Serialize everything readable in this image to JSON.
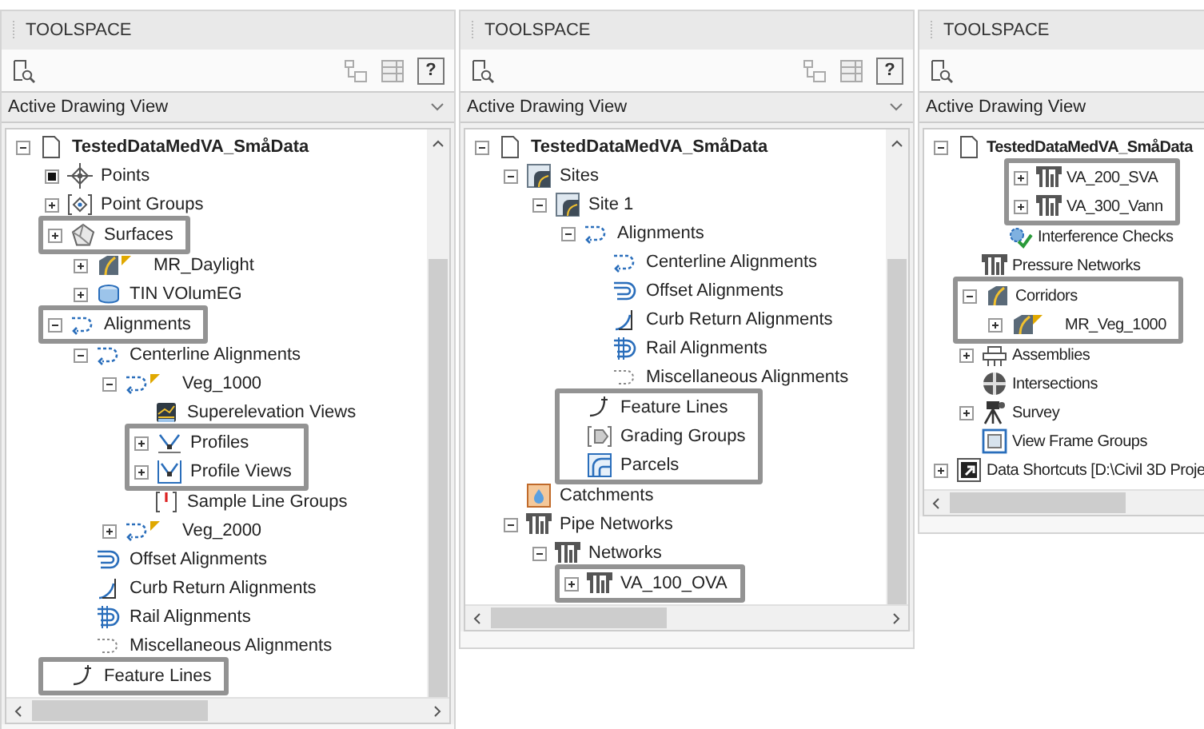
{
  "panels": [
    {
      "title": "TOOLSPACE",
      "view": "Active Drawing View",
      "help": "?",
      "clipped_right": false,
      "tree": [
        {
          "label": "TestedDataMedVA_SmåData",
          "expanded": true,
          "kind": "document",
          "highlighted": false,
          "children": [
            {
              "label": "Points",
              "filled_marker": true,
              "kind": "points",
              "highlighted": false
            },
            {
              "label": "Point Groups",
              "expanded": false,
              "kind": "point-groups",
              "highlighted": false
            },
            {
              "label": "Surfaces",
              "expanded": false,
              "kind": "surface",
              "highlighted": true,
              "children": [
                {
                  "label": "MR_Daylight",
                  "expanded": false,
                  "kind": "corridor",
                  "flag": true,
                  "highlighted": false
                },
                {
                  "label": "TIN VOlumEG",
                  "expanded": false,
                  "kind": "tin",
                  "highlighted": false
                }
              ]
            },
            {
              "label": "Alignments",
              "expanded": true,
              "kind": "alignment",
              "highlighted": true,
              "children": [
                {
                  "label": "Centerline Alignments",
                  "expanded": true,
                  "kind": "alignment",
                  "highlighted": false,
                  "children": [
                    {
                      "label": "Veg_1000",
                      "expanded": true,
                      "kind": "alignment",
                      "flag": true,
                      "highlighted": false,
                      "children": [
                        {
                          "label": "Superelevation Views",
                          "kind": "superelevation",
                          "highlighted": false
                        },
                        {
                          "label": "Profiles",
                          "expanded": false,
                          "kind": "profile",
                          "highlighted": true
                        },
                        {
                          "label": "Profile Views",
                          "expanded": false,
                          "kind": "profile-view",
                          "highlighted": true
                        },
                        {
                          "label": "Sample Line Groups",
                          "kind": "sample-lines",
                          "highlighted": false
                        }
                      ]
                    },
                    {
                      "label": "Veg_2000",
                      "expanded": false,
                      "kind": "alignment",
                      "flag": true,
                      "highlighted": false
                    }
                  ]
                },
                {
                  "label": "Offset Alignments",
                  "kind": "offset-alignment",
                  "highlighted": false
                },
                {
                  "label": "Curb Return Alignments",
                  "kind": "curb-return",
                  "highlighted": false
                },
                {
                  "label": "Rail Alignments",
                  "kind": "rail-alignment",
                  "highlighted": false
                },
                {
                  "label": "Miscellaneous Alignments",
                  "kind": "misc-alignment",
                  "highlighted": false
                }
              ]
            },
            {
              "label": "Feature Lines",
              "kind": "feature-line",
              "highlighted": true
            }
          ]
        }
      ]
    },
    {
      "title": "TOOLSPACE",
      "view": "Active Drawing View",
      "help": "?",
      "clipped_right": false,
      "tree": [
        {
          "label": "TestedDataMedVA_SmåData",
          "expanded": true,
          "kind": "document",
          "highlighted": false,
          "children": [
            {
              "label": "Sites",
              "expanded": true,
              "kind": "sites",
              "highlighted": false,
              "children": [
                {
                  "label": "Site 1",
                  "expanded": true,
                  "kind": "sites",
                  "highlighted": false,
                  "children": [
                    {
                      "label": "Alignments",
                      "expanded": true,
                      "kind": "alignment",
                      "highlighted": false,
                      "children": [
                        {
                          "label": "Centerline Alignments",
                          "kind": "alignment",
                          "highlighted": false
                        },
                        {
                          "label": "Offset Alignments",
                          "kind": "offset-alignment",
                          "highlighted": false
                        },
                        {
                          "label": "Curb Return Alignments",
                          "kind": "curb-return",
                          "highlighted": false
                        },
                        {
                          "label": "Rail Alignments",
                          "kind": "rail-alignment",
                          "highlighted": false
                        },
                        {
                          "label": "Miscellaneous Alignments",
                          "kind": "misc-alignment",
                          "highlighted": false
                        }
                      ]
                    },
                    {
                      "label": "Feature Lines",
                      "kind": "feature-line",
                      "highlighted": true
                    },
                    {
                      "label": "Grading Groups",
                      "kind": "grading",
                      "highlighted": true
                    },
                    {
                      "label": "Parcels",
                      "kind": "parcels",
                      "highlighted": true
                    }
                  ]
                }
              ]
            },
            {
              "label": "Catchments",
              "kind": "catchments",
              "highlighted": false
            },
            {
              "label": "Pipe Networks",
              "expanded": true,
              "kind": "pipe",
              "highlighted": false,
              "children": [
                {
                  "label": "Networks",
                  "expanded": true,
                  "kind": "pipe",
                  "highlighted": false,
                  "children": [
                    {
                      "label": "VA_100_OVA",
                      "expanded": false,
                      "kind": "pipe",
                      "highlighted": true
                    }
                  ]
                }
              ]
            }
          ]
        }
      ]
    },
    {
      "title": "TOOLSPACE",
      "view": "Active Drawing View",
      "clipped_right": true,
      "tree": [
        {
          "label": "TestedDataMedVA_SmåData",
          "expanded": true,
          "kind": "document",
          "highlighted": false,
          "children": [
            {
              "children": [
                {
                  "children": [
                    {
                      "label": "VA_200_SVA",
                      "expanded": false,
                      "kind": "pipe",
                      "highlighted": true
                    },
                    {
                      "label": "VA_300_Vann",
                      "expanded": false,
                      "kind": "pipe",
                      "highlighted": true
                    }
                  ]
                },
                {
                  "label": "Interference Checks",
                  "kind": "interference",
                  "highlighted": false
                }
              ]
            },
            {
              "label": "Pressure Networks",
              "kind": "pipe",
              "highlighted": false
            },
            {
              "label": "Corridors",
              "expanded": true,
              "kind": "corridor",
              "highlighted": true,
              "children": [
                {
                  "label": "MR_Veg_1000",
                  "expanded": false,
                  "kind": "corridor",
                  "flag": true,
                  "highlighted": true
                }
              ]
            },
            {
              "label": "Assemblies",
              "expanded": false,
              "kind": "assembly",
              "highlighted": false
            },
            {
              "label": "Intersections",
              "kind": "intersection",
              "highlighted": false
            },
            {
              "label": "Survey",
              "expanded": false,
              "kind": "survey",
              "highlighted": false
            },
            {
              "label": "View Frame Groups",
              "kind": "view-frame",
              "highlighted": false
            }
          ]
        },
        {
          "label": "Data Shortcuts [D:\\Civil 3D Proje",
          "expanded": false,
          "kind": "shortcut",
          "highlighted": false
        }
      ]
    }
  ]
}
